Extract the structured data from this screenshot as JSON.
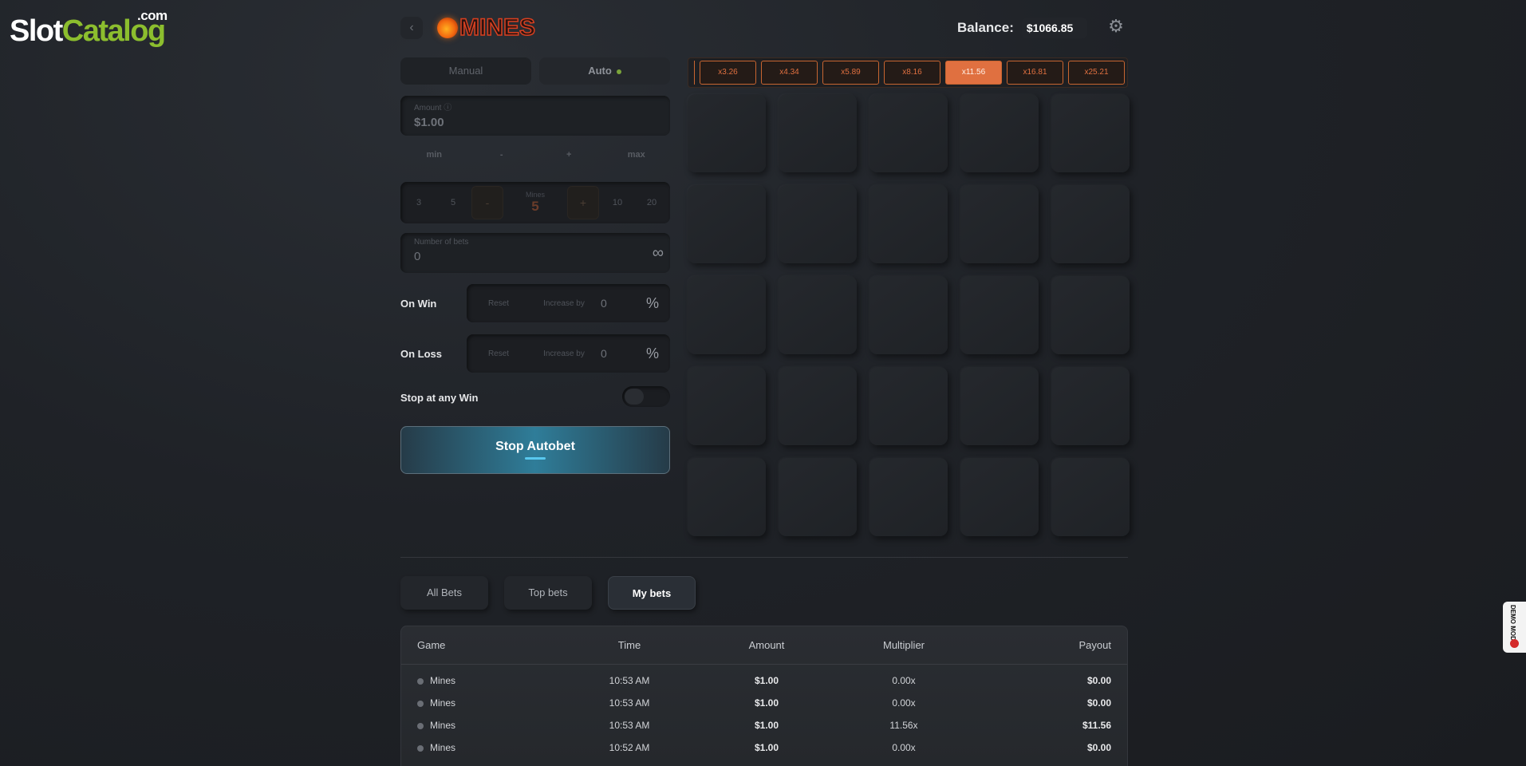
{
  "watermark": {
    "main_a": "Slot",
    "main_b": "Catalog",
    "sub": ".com"
  },
  "header": {
    "back_icon": "‹",
    "game_title": "MINES",
    "balance_label": "Balance:",
    "balance_value": "$1066.85",
    "settings_icon": "⚙"
  },
  "mode_tabs": {
    "manual": "Manual",
    "auto": "Auto"
  },
  "amount": {
    "label": "Amount ⓘ",
    "value": "$1.00",
    "min": "min",
    "minus": "-",
    "plus": "+",
    "max": "max"
  },
  "mines": {
    "preset_a": "3",
    "preset_b": "5",
    "minus": "-",
    "label": "Mines",
    "value": "5",
    "plus": "+",
    "preset_c": "10",
    "preset_d": "20"
  },
  "number_of_bets": {
    "label": "Number of bets",
    "value": "0",
    "infinity": "∞"
  },
  "on_win": {
    "label": "On Win",
    "reset": "Reset",
    "increase": "Increase by",
    "value": "0",
    "unit": "%"
  },
  "on_loss": {
    "label": "On Loss",
    "reset": "Reset",
    "increase": "Increase by",
    "value": "0",
    "unit": "%"
  },
  "stop_any_win": {
    "label": "Stop at any Win",
    "enabled": false
  },
  "stop_button": "Stop Autobet",
  "multipliers": [
    {
      "label": "x3.26",
      "active": false
    },
    {
      "label": "x4.34",
      "active": false
    },
    {
      "label": "x5.89",
      "active": false
    },
    {
      "label": "x8.16",
      "active": false
    },
    {
      "label": "x11.56",
      "active": true
    },
    {
      "label": "x16.81",
      "active": false
    },
    {
      "label": "x25.21",
      "active": false
    }
  ],
  "bets_tabs": {
    "all": "All Bets",
    "top": "Top bets",
    "mine": "My bets"
  },
  "table": {
    "headers": {
      "game": "Game",
      "time": "Time",
      "amount": "Amount",
      "multiplier": "Multiplier",
      "payout": "Payout"
    },
    "rows": [
      {
        "game": "Mines",
        "time": "10:53 AM",
        "amount": "$1.00",
        "multiplier": "0.00x",
        "payout": "$0.00"
      },
      {
        "game": "Mines",
        "time": "10:53 AM",
        "amount": "$1.00",
        "multiplier": "0.00x",
        "payout": "$0.00"
      },
      {
        "game": "Mines",
        "time": "10:53 AM",
        "amount": "$1.00",
        "multiplier": "11.56x",
        "payout": "$11.56"
      },
      {
        "game": "Mines",
        "time": "10:52 AM",
        "amount": "$1.00",
        "multiplier": "0.00x",
        "payout": "$0.00"
      }
    ]
  },
  "demo_badge": "DEMO MODE",
  "colors": {
    "accent_orange": "#e07040",
    "stop_button_blue": "#2f7d99",
    "brand_green": "#8cbe2e"
  }
}
